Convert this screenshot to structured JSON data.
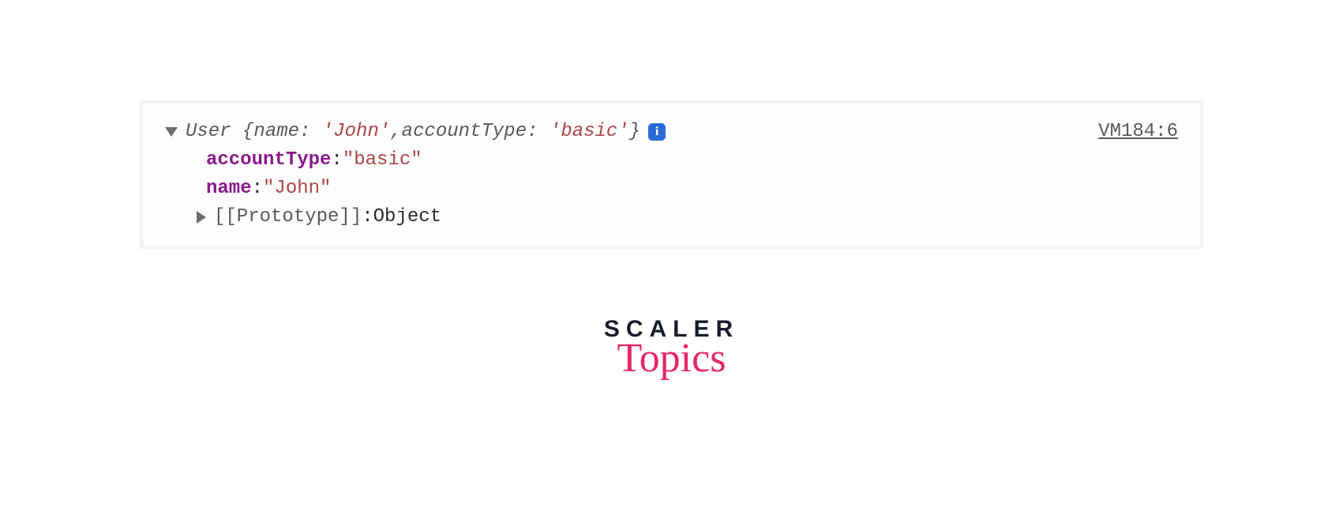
{
  "console": {
    "header": {
      "constructor": "User",
      "preview_open": "{",
      "key1": "name",
      "val1": "'John'",
      "sep": ", ",
      "key2": "accountType",
      "val2": "'basic'",
      "preview_close": "}",
      "info_glyph": "i",
      "source": "VM184:6"
    },
    "props": [
      {
        "key": "accountType",
        "colon": ": ",
        "value": "\"basic\""
      },
      {
        "key": "name",
        "colon": ": ",
        "value": "\"John\""
      }
    ],
    "proto": {
      "label": "[[Prototype]]",
      "colon": ": ",
      "value": "Object"
    }
  },
  "branding": {
    "line1": "SCALER",
    "line2": "Topics"
  }
}
